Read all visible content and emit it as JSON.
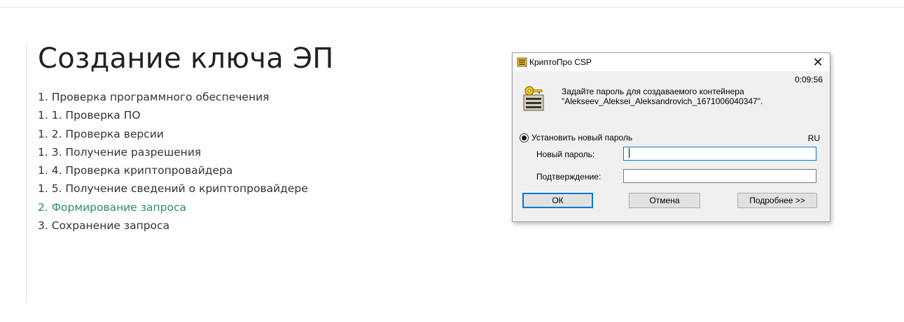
{
  "page": {
    "title": "Создание ключа ЭП",
    "steps": [
      {
        "label": "1. Проверка программного обеспечения",
        "active": false
      },
      {
        "label": "1. 1. Проверка ПО",
        "active": false
      },
      {
        "label": "1. 2. Проверка версии",
        "active": false
      },
      {
        "label": "1. 3. Получение разрешения",
        "active": false
      },
      {
        "label": "1. 4. Проверка криптопровайдера",
        "active": false
      },
      {
        "label": "1. 5. Получение сведений о криптопровайдере",
        "active": false
      },
      {
        "label": "2. Формирование запроса",
        "active": true
      },
      {
        "label": "3. Сохранение запроса",
        "active": false
      }
    ],
    "active_color": "#2e8b68"
  },
  "dialog": {
    "title": "КриптоПро CSP",
    "app_icon": "cryptopro-icon",
    "close_glyph": "✕",
    "timer": "0:09:56",
    "message_line1": "Задайте пароль для создаваемого контейнера",
    "message_line2": "\"Alekseev_Aleksei_Aleksandrovich_1671006040347\".",
    "radio_label": "Установить новый пароль",
    "radio_checked": true,
    "language": "RU",
    "new_password_label": "Новый пароль:",
    "new_password_value": "",
    "confirm_label": "Подтверждение:",
    "confirm_value": "",
    "ok_label": "ОК",
    "cancel_label": "Отмена",
    "details_label": "Подробнее >>",
    "accent_color": "#0078d7"
  }
}
